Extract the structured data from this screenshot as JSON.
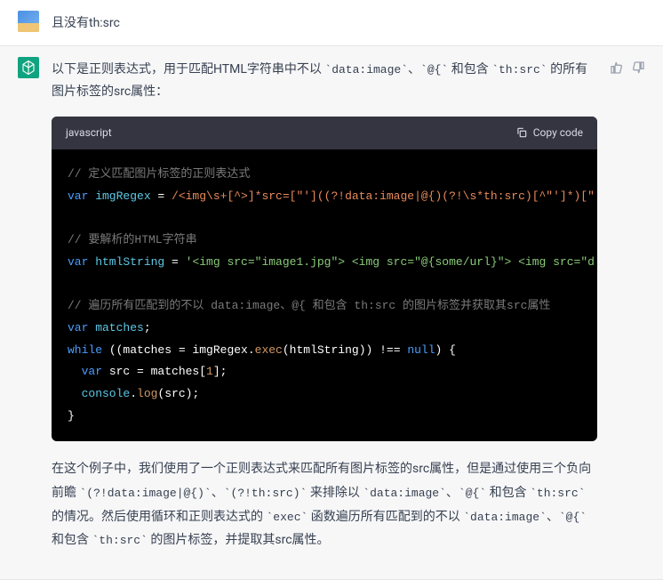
{
  "userMessage": {
    "text": "且没有th:src"
  },
  "assistantMessage": {
    "intro_p1": "以下是正则表达式，用于匹配HTML字符串中不以 ",
    "intro_c1": "`data:image`",
    "intro_p2": "、",
    "intro_c2": "`@{`",
    "intro_p3": " 和包含 ",
    "intro_c3": "`th:src`",
    "intro_p4": " 的所有图片标签的src属性：",
    "codeHeader": {
      "lang": "javascript",
      "copy": "Copy code"
    },
    "code": {
      "l1_comment": "// 定义匹配图片标签的正则表达式",
      "l2_kw": "var",
      "l2_name": " imgRegex ",
      "l2_eq": "= ",
      "l2_regex": "/<img\\s+[^>]*src=[\"']((?!data:image|@{)(?!\\s*th:src)[^\"']*)[\"",
      "l3_comment": "// 要解析的HTML字符串",
      "l4_kw": "var",
      "l4_name": " htmlString ",
      "l4_eq": "= ",
      "l4_str": "'<img src=\"image1.jpg\"> <img src=\"@{some/url}\"> <img src=\"d",
      "l5_comment": "// 遍历所有匹配到的不以 data:image、@{ 和包含 th:src 的图片标签并获取其src属性",
      "l6_kw": "var",
      "l6_name": " matches",
      "l6_semi": ";",
      "l7_kw": "while",
      "l7_p1": " ((matches = imgRegex.",
      "l7_method": "exec",
      "l7_p2": "(htmlString)) !== ",
      "l7_null": "null",
      "l7_p3": ") {",
      "l8_kw": "  var",
      "l8_p1": " src = matches[",
      "l8_num": "1",
      "l8_p2": "];",
      "l9_obj": "  console",
      "l9_dot": ".",
      "l9_method": "log",
      "l9_p": "(src);",
      "l10": "}"
    },
    "expl_p1": "在这个例子中，我们使用了一个正则表达式来匹配所有图片标签的src属性，但是通过使用三个负向前瞻 ",
    "expl_c1": "`(?!data:image|@{)`",
    "expl_p2": "、",
    "expl_c2": "`(?!th:src)`",
    "expl_p3": " 来排除以 ",
    "expl_c3": "`data:image`",
    "expl_p4": "、",
    "expl_c4": "`@{`",
    "expl_p5": " 和包含 ",
    "expl_c5": "`th:src`",
    "expl_p6": " 的情况。然后使用循环和正则表达式的 ",
    "expl_c6": "`exec`",
    "expl_p7": " 函数遍历所有匹配到的不以 ",
    "expl_c7": "`data:image`",
    "expl_p8": "、",
    "expl_c8": "`@{`",
    "expl_p9": " 和包含 ",
    "expl_c9": "`th:src`",
    "expl_p10": " 的图片标签，并提取其src属性。"
  }
}
